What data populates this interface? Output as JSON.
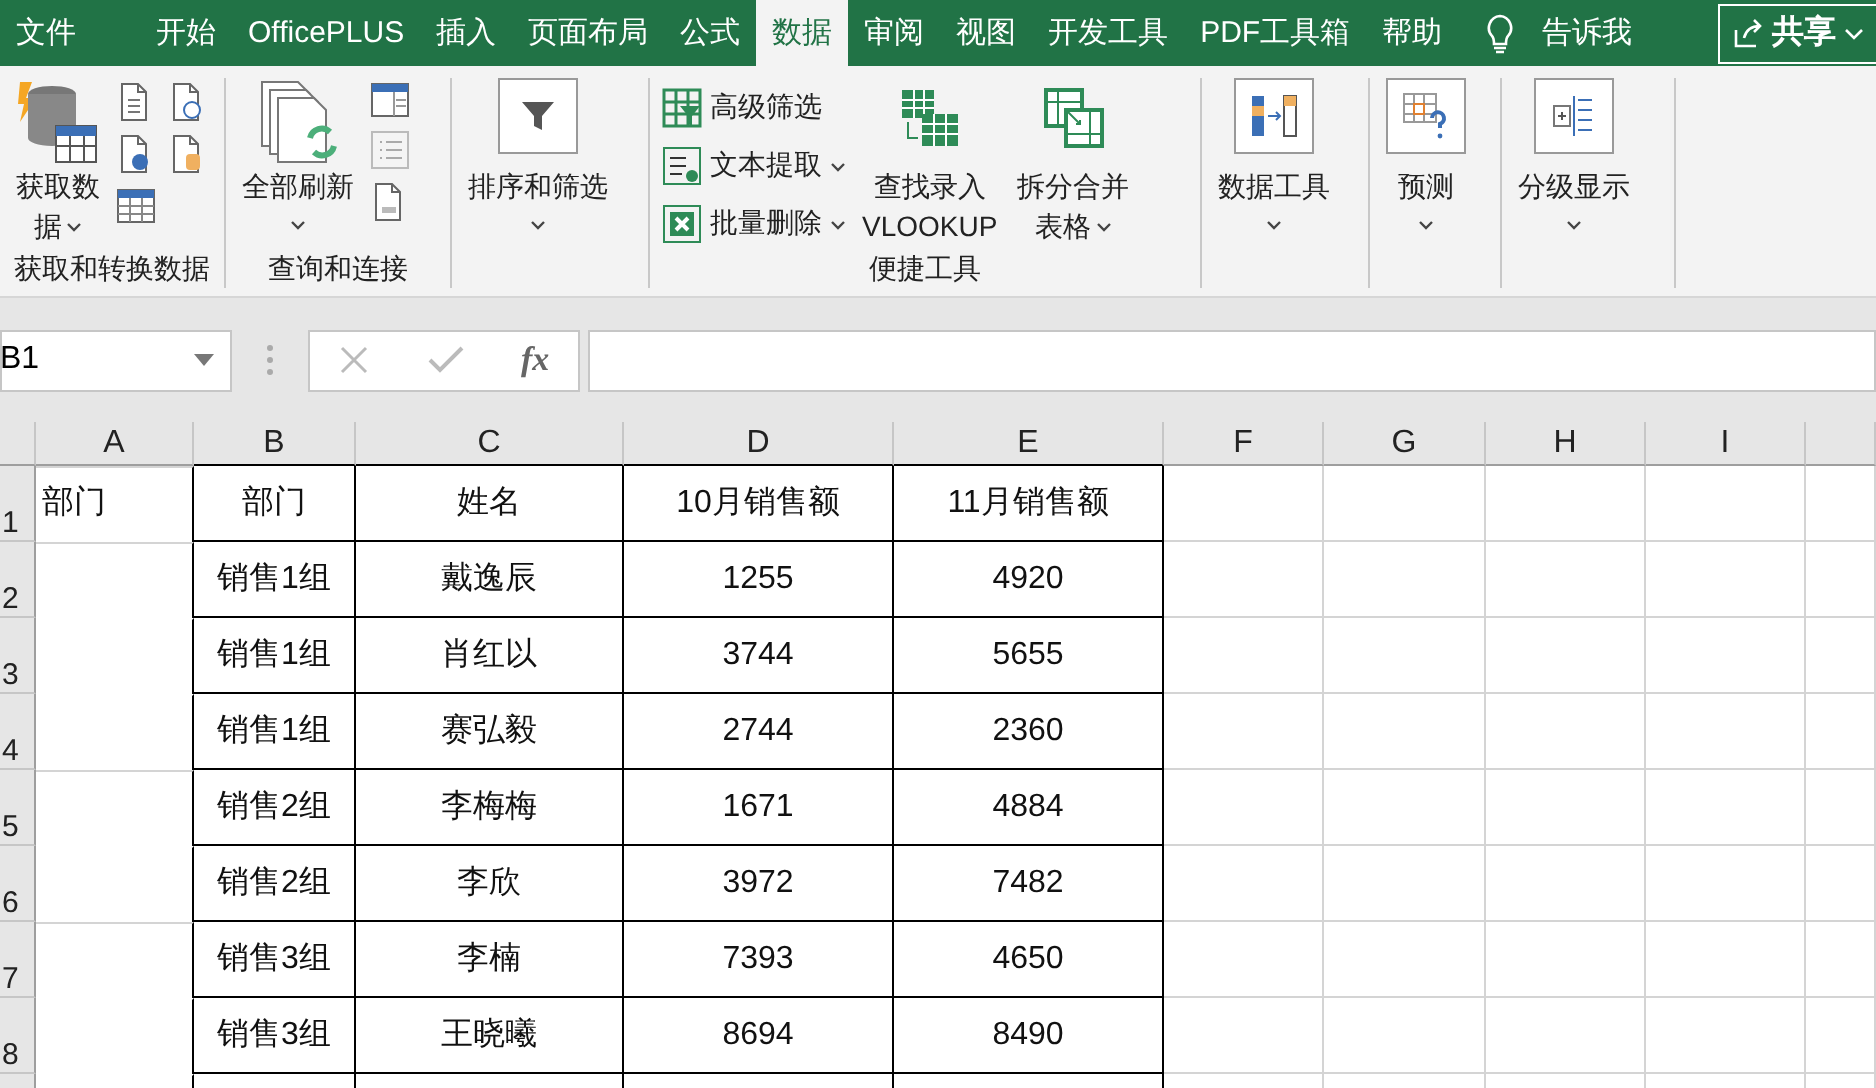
{
  "tabs": [
    {
      "label": "文件",
      "selected": false
    },
    {
      "label": "开始",
      "selected": false
    },
    {
      "label": "OfficePLUS",
      "selected": false
    },
    {
      "label": "插入",
      "selected": false
    },
    {
      "label": "页面布局",
      "selected": false
    },
    {
      "label": "公式",
      "selected": false
    },
    {
      "label": "数据",
      "selected": true
    },
    {
      "label": "审阅",
      "selected": false
    },
    {
      "label": "视图",
      "selected": false
    },
    {
      "label": "开发工具",
      "selected": false
    },
    {
      "label": "PDF工具箱",
      "selected": false
    },
    {
      "label": "帮助",
      "selected": false
    }
  ],
  "tell_me": {
    "label": "告诉我"
  },
  "share_button": {
    "label": "共享",
    "dropdown": true
  },
  "ribbon_groups": [
    {
      "kind": "get",
      "label": "获取和转换数据",
      "button": {
        "lines": [
          "获取数",
          "据"
        ],
        "dropdown": true
      }
    },
    {
      "kind": "query",
      "label": "查询和连接",
      "button": {
        "lines": [
          "全部刷新"
        ],
        "dropdown": true
      }
    },
    {
      "kind": "sort",
      "button": {
        "lines": [
          "排序和筛选"
        ],
        "dropdown": true
      }
    },
    {
      "kind": "tools",
      "label": "便捷工具",
      "items": [
        {
          "label": "高级筛选",
          "dropdown": false
        },
        {
          "label": "文本提取",
          "dropdown": true
        },
        {
          "label": "批量删除",
          "dropdown": true
        }
      ],
      "buttons": [
        {
          "lines": [
            "查找录入",
            "VLOOKUP"
          ],
          "dropdown": false
        },
        {
          "lines": [
            "拆分合并",
            "表格"
          ],
          "dropdown": true
        }
      ]
    },
    {
      "kind": "data_tools",
      "button": {
        "lines": [
          "数据工具"
        ],
        "dropdown": true
      }
    },
    {
      "kind": "forecast",
      "button": {
        "lines": [
          "预测"
        ],
        "dropdown": true
      }
    },
    {
      "kind": "outline",
      "button": {
        "lines": [
          "分级显示"
        ],
        "dropdown": true
      }
    }
  ],
  "formula_bar": {
    "name_box": "B1",
    "function_label": "fx"
  },
  "sheet": {
    "columns": [
      "A",
      "B",
      "C",
      "D",
      "E",
      "F",
      "G",
      "H",
      "I"
    ],
    "rows": [
      {
        "number": "1",
        "a_text": "部门",
        "a_continued": false,
        "cells": [
          "部门",
          "姓名",
          "10月销售额",
          "11月销售额"
        ]
      },
      {
        "number": "2",
        "a_continued": false,
        "cells": [
          "销售1组",
          "戴逸辰",
          "1255",
          "4920"
        ]
      },
      {
        "number": "3",
        "a_continued": true,
        "cells": [
          "销售1组",
          "肖红以",
          "3744",
          "5655"
        ]
      },
      {
        "number": "4",
        "a_continued": true,
        "cells": [
          "销售1组",
          "赛弘毅",
          "2744",
          "2360"
        ]
      },
      {
        "number": "5",
        "a_continued": false,
        "cells": [
          "销售2组",
          "李梅梅",
          "1671",
          "4884"
        ]
      },
      {
        "number": "6",
        "a_continued": true,
        "cells": [
          "销售2组",
          "李欣",
          "3972",
          "7482"
        ]
      },
      {
        "number": "7",
        "a_continued": false,
        "cells": [
          "销售3组",
          "李楠",
          "7393",
          "4650"
        ]
      },
      {
        "number": "8",
        "a_continued": true,
        "cells": [
          "销售3组",
          "王晓曦",
          "8694",
          "8490"
        ]
      },
      {
        "a_continued": true
      }
    ]
  }
}
